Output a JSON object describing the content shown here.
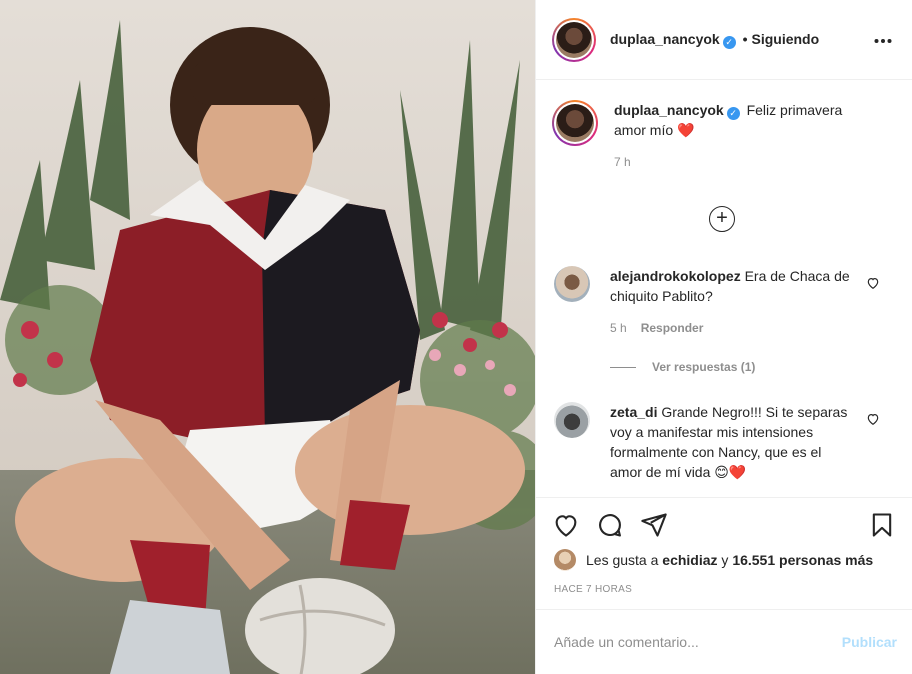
{
  "header": {
    "username": "duplaa_nancyok",
    "verified_mark": "✓",
    "dot": "•",
    "follow_label": "Siguiendo",
    "more_label": "•••"
  },
  "caption": {
    "username": "duplaa_nancyok",
    "text": "Feliz primavera amor mío",
    "emoji": "❤️",
    "time": "7 h"
  },
  "load_more_label": "+",
  "comments": [
    {
      "username": "alejandrokokolopez",
      "text": "Era de Chaca de chiquito Pablito?",
      "time": "5 h",
      "reply_label": "Responder",
      "view_replies": "Ver respuestas (1)"
    },
    {
      "username": "zeta_di",
      "text": "Grande Negro!!! Si te separas voy a manifestar mis intensiones formalmente con Nancy, que es el amor de mí vida",
      "emoji": "😊❤️"
    }
  ],
  "likes": {
    "prefix": "Les gusta a",
    "user": "echidiaz",
    "connector": "y",
    "count": "16.551 personas más"
  },
  "posted_ago": "HACE 7 HORAS",
  "add_comment": {
    "placeholder": "Añade un comentario...",
    "publish_label": "Publicar"
  },
  "icons": [
    "more-options-icon",
    "verified-badge-icon",
    "plus-circle-icon",
    "heart-icon",
    "comment-icon",
    "share-icon",
    "bookmark-icon"
  ],
  "colors": {
    "link_blue": "#3897f0",
    "publish_disabled": "#b2dffc",
    "muted": "#8e8e8e",
    "heart_red": "#ed4956"
  }
}
